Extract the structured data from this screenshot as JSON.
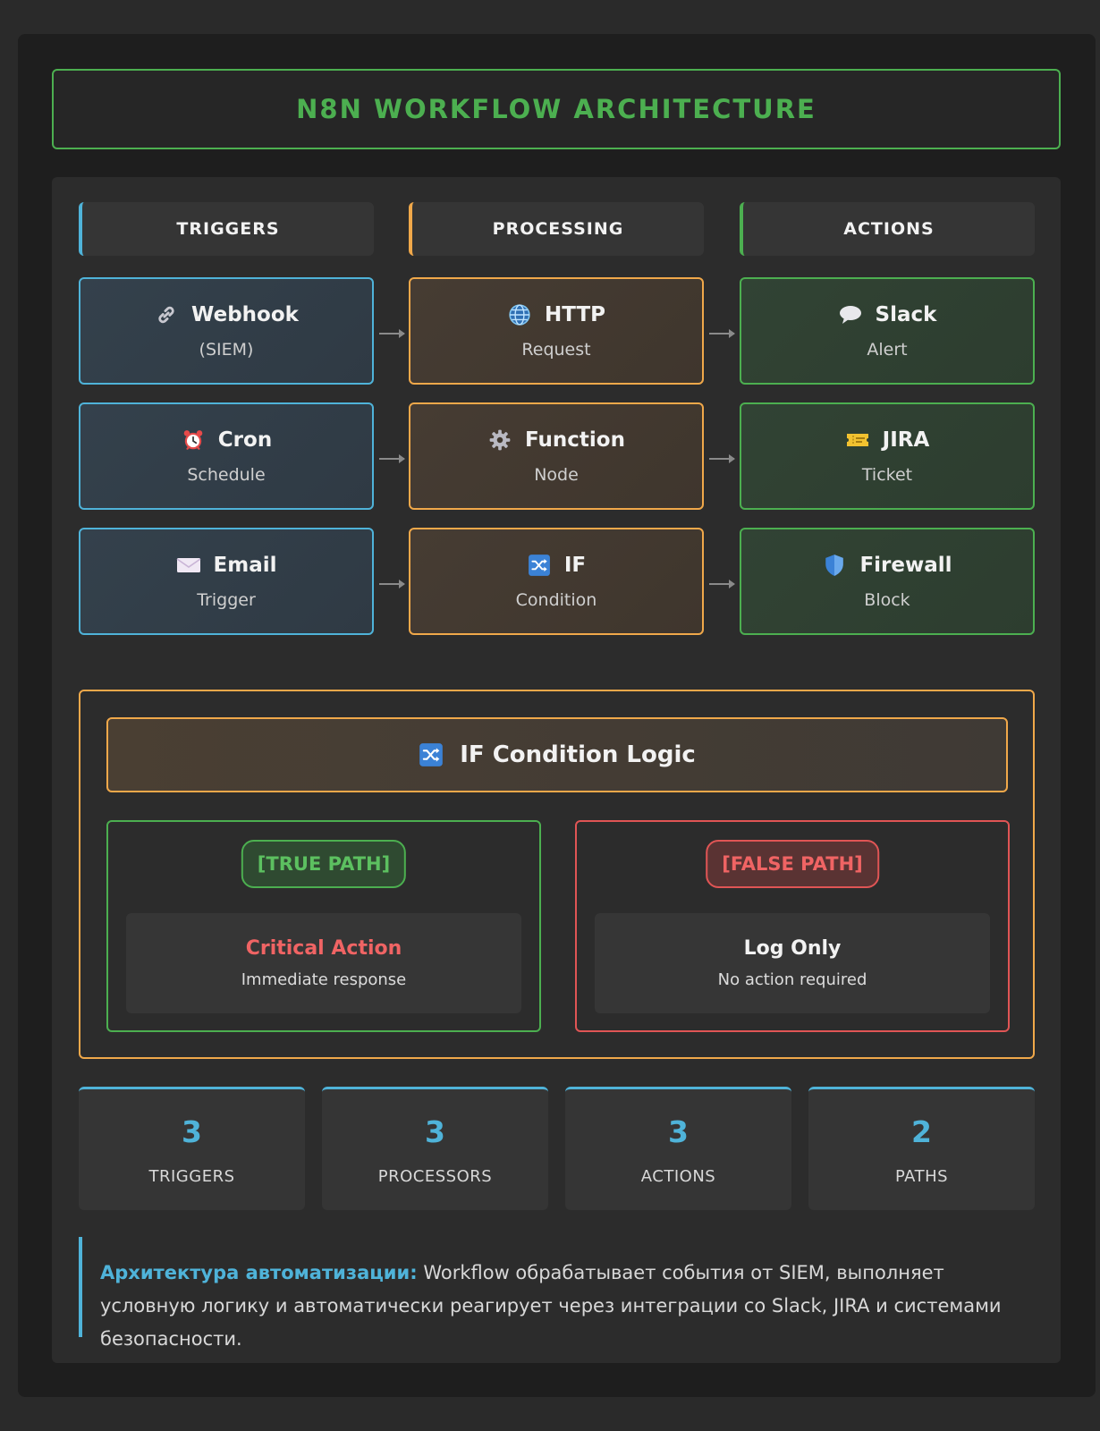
{
  "title": "N8N WORKFLOW ARCHITECTURE",
  "columns": {
    "triggers": "TRIGGERS",
    "processing": "PROCESSING",
    "actions": "ACTIONS"
  },
  "nodes": {
    "triggers": [
      {
        "icon": "link-icon",
        "name": "Webhook",
        "sub": "(SIEM)"
      },
      {
        "icon": "alarm-clock-icon",
        "name": "Cron",
        "sub": "Schedule"
      },
      {
        "icon": "envelope-icon",
        "name": "Email",
        "sub": "Trigger"
      }
    ],
    "processing": [
      {
        "icon": "globe-icon",
        "name": "HTTP",
        "sub": "Request"
      },
      {
        "icon": "gear-icon",
        "name": "Function",
        "sub": "Node"
      },
      {
        "icon": "shuffle-icon",
        "name": "IF",
        "sub": "Condition"
      }
    ],
    "actions": [
      {
        "icon": "speech-bubble-icon",
        "name": "Slack",
        "sub": "Alert"
      },
      {
        "icon": "ticket-icon",
        "name": "JIRA",
        "sub": "Ticket"
      },
      {
        "icon": "shield-icon",
        "name": "Firewall",
        "sub": "Block"
      }
    ]
  },
  "if_logic": {
    "title": "IF Condition Logic",
    "true_path": {
      "badge": "[TRUE PATH]",
      "heading": "Critical Action",
      "desc": "Immediate response"
    },
    "false_path": {
      "badge": "[FALSE PATH]",
      "heading": "Log Only",
      "desc": "No action required"
    }
  },
  "stats": [
    {
      "value": "3",
      "label": "TRIGGERS"
    },
    {
      "value": "3",
      "label": "PROCESSORS"
    },
    {
      "value": "3",
      "label": "ACTIONS"
    },
    {
      "value": "2",
      "label": "PATHS"
    }
  ],
  "note": {
    "lead": "Архитектура автоматизации:",
    "text": " Workflow обрабатывает события от SIEM, выполняет условную логику и автоматически реагирует через интеграции со Slack, JIRA и системами безопасности."
  },
  "colors": {
    "triggers": "#4fb3d9",
    "processing": "#f0a84a",
    "actions": "#4caf50",
    "false": "#e05555"
  }
}
